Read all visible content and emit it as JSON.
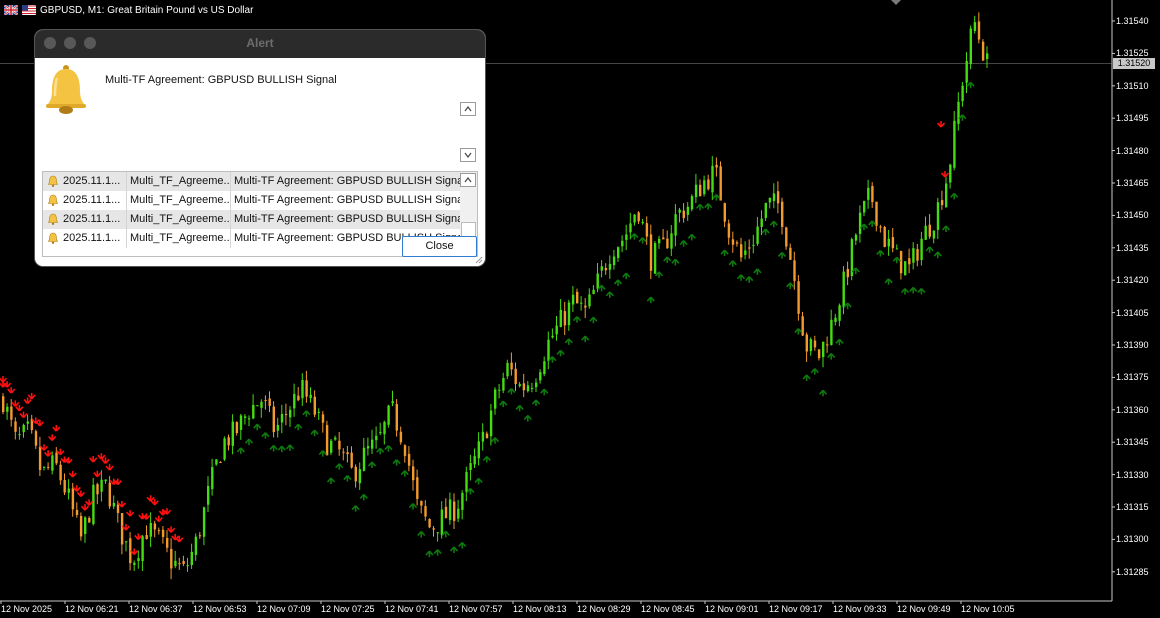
{
  "chart": {
    "header_title": "GBPUSD, M1:  Great Britain Pound vs US Dollar",
    "current_price": "1.31520",
    "price_axis": [
      "1.31540",
      "1.31525",
      "1.31510",
      "1.31495",
      "1.31480",
      "1.31465",
      "1.31450",
      "1.31435",
      "1.31420",
      "1.31405",
      "1.31390",
      "1.31375",
      "1.31360",
      "1.31345",
      "1.31330",
      "1.31315",
      "1.31300",
      "1.31285"
    ],
    "time_axis": [
      "12 Nov 2025",
      "12 Nov 06:21",
      "12 Nov 06:37",
      "12 Nov 06:53",
      "12 Nov 07:09",
      "12 Nov 07:25",
      "12 Nov 07:41",
      "12 Nov 07:57",
      "12 Nov 08:13",
      "12 Nov 08:29",
      "12 Nov 08:45",
      "12 Nov 09:01",
      "12 Nov 09:17",
      "12 Nov 09:33",
      "12 Nov 09:49",
      "12 Nov 10:05"
    ],
    "colors": {
      "background": "#000000",
      "bull_candle": "#44dd11",
      "bear_candle": "#f39a2f",
      "buy_arrow": "#0e7a0e",
      "sell_arrow": "#ff1010",
      "axis": "#c8c8c8"
    }
  },
  "chart_data": {
    "type": "candlestick",
    "ylim": [
      1.31278,
      1.31552
    ],
    "x_range": [
      "12 Nov 06:05",
      "12 Nov 10:12"
    ],
    "close_profile": [
      [
        0,
        1.31365
      ],
      [
        10,
        1.31345
      ],
      [
        20,
        1.3135
      ],
      [
        30,
        1.3133
      ],
      [
        40,
        1.31335
      ],
      [
        50,
        1.3132
      ],
      [
        60,
        1.313
      ],
      [
        70,
        1.3132
      ],
      [
        80,
        1.31325
      ],
      [
        90,
        1.31305
      ],
      [
        100,
        1.3129
      ],
      [
        110,
        1.31305
      ],
      [
        120,
        1.313
      ],
      [
        130,
        1.3129
      ],
      [
        140,
        1.31285
      ],
      [
        150,
        1.313
      ],
      [
        160,
        1.31325
      ],
      [
        170,
        1.31345
      ],
      [
        180,
        1.3135
      ],
      [
        190,
        1.3136
      ],
      [
        200,
        1.31365
      ],
      [
        210,
        1.3135
      ],
      [
        220,
        1.3136
      ],
      [
        230,
        1.3137
      ],
      [
        240,
        1.3136
      ],
      [
        250,
        1.31345
      ],
      [
        260,
        1.3134
      ],
      [
        270,
        1.3133
      ],
      [
        280,
        1.3134
      ],
      [
        290,
        1.31345
      ],
      [
        300,
        1.3136
      ],
      [
        310,
        1.31345
      ],
      [
        320,
        1.31315
      ],
      [
        330,
        1.31305
      ],
      [
        340,
        1.3131
      ],
      [
        350,
        1.31315
      ],
      [
        360,
        1.3133
      ],
      [
        370,
        1.31345
      ],
      [
        380,
        1.31365
      ],
      [
        390,
        1.3138
      ],
      [
        400,
        1.3137
      ],
      [
        410,
        1.31375
      ],
      [
        420,
        1.3139
      ],
      [
        430,
        1.314
      ],
      [
        440,
        1.3141
      ],
      [
        450,
        1.31405
      ],
      [
        460,
        1.3142
      ],
      [
        470,
        1.31435
      ],
      [
        480,
        1.3144
      ],
      [
        490,
        1.31455
      ],
      [
        500,
        1.3143
      ],
      [
        510,
        1.31435
      ],
      [
        520,
        1.3145
      ],
      [
        530,
        1.31455
      ],
      [
        540,
        1.31465
      ],
      [
        550,
        1.3147
      ],
      [
        560,
        1.31445
      ],
      [
        570,
        1.3143
      ],
      [
        580,
        1.3144
      ],
      [
        590,
        1.31455
      ],
      [
        600,
        1.31455
      ],
      [
        610,
        1.31425
      ],
      [
        620,
        1.3139
      ],
      [
        630,
        1.31385
      ],
      [
        640,
        1.314
      ],
      [
        650,
        1.3142
      ],
      [
        660,
        1.31445
      ],
      [
        670,
        1.3146
      ],
      [
        680,
        1.3144
      ],
      [
        690,
        1.3143
      ],
      [
        700,
        1.31425
      ],
      [
        710,
        1.3144
      ],
      [
        720,
        1.3145
      ],
      [
        730,
        1.3147
      ],
      [
        740,
        1.3151
      ],
      [
        750,
        1.3154
      ],
      [
        755,
        1.3153
      ],
      [
        760,
        1.3152
      ]
    ],
    "buy_signal_arrows": 90,
    "sell_signal_arrows": 45
  },
  "alert": {
    "title": "Alert",
    "message": "Multi-TF Agreement: GBPUSD BULLISH Signal",
    "history": [
      {
        "time": "2025.11.1...",
        "name": "Multi_TF_Agreeme...",
        "message": "Multi-TF Agreement: GBPUSD BULLISH Signal"
      },
      {
        "time": "2025.11.1...",
        "name": "Multi_TF_Agreeme...",
        "message": "Multi-TF Agreement: GBPUSD BULLISH Signal"
      },
      {
        "time": "2025.11.1...",
        "name": "Multi_TF_Agreeme...",
        "message": "Multi-TF Agreement: GBPUSD BULLISH Signal"
      },
      {
        "time": "2025.11.1...",
        "name": "Multi_TF_Agreeme...",
        "message": "Multi-TF Agreement: GBPUSD BULLISH Signal"
      }
    ],
    "close_label": "Close",
    "bell_color": "#f5c342"
  }
}
